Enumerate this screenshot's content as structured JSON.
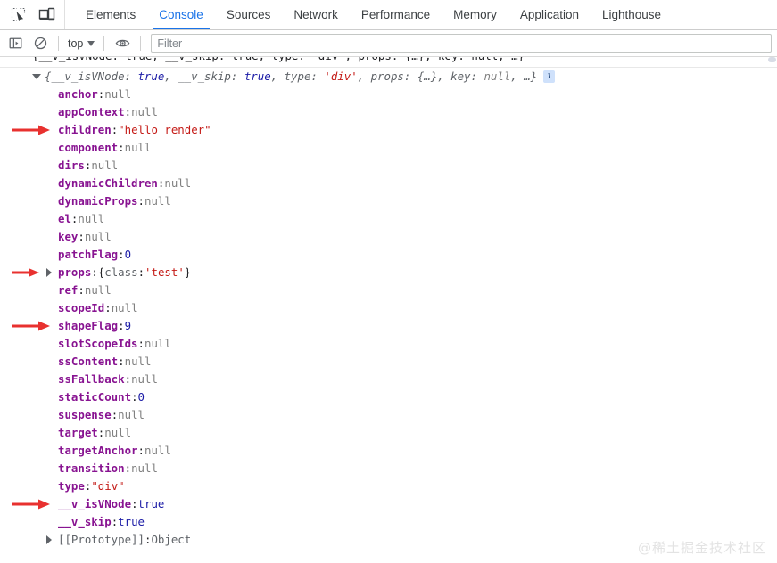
{
  "devtools": {
    "left_icons": [
      {
        "name": "inspect-element-icon",
        "title": "Inspect element"
      },
      {
        "name": "device-toolbar-icon",
        "title": "Toggle device toolbar"
      }
    ],
    "tabs": [
      {
        "label": "Elements",
        "active": false
      },
      {
        "label": "Console",
        "active": true
      },
      {
        "label": "Sources",
        "active": false
      },
      {
        "label": "Network",
        "active": false
      },
      {
        "label": "Performance",
        "active": false
      },
      {
        "label": "Memory",
        "active": false
      },
      {
        "label": "Application",
        "active": false
      },
      {
        "label": "Lighthouse",
        "active": false
      }
    ],
    "active_tab_color": "#1a73e8"
  },
  "controls": {
    "sidebar_toggle_icon": "show-console-sidebar-icon",
    "clear_console_icon": "clear-console-icon",
    "context_label": "top",
    "context_caret_icon": "chevron-down-icon",
    "eye_icon": "live-expression-eye-icon",
    "filter": {
      "value": "",
      "placeholder": "Filter"
    }
  },
  "console": {
    "clipped_top_line": "{__v_isVNode: true, __v_skip: true, type: 'div', props: {…}, key: null, …}",
    "object_header": {
      "expander_icon": "triangle-down-icon",
      "open_brace": "{",
      "close_brace": "}",
      "parts": [
        {
          "key": "__v_isVNode",
          "value": "true",
          "kind": "bool"
        },
        {
          "key": "__v_skip",
          "value": "true",
          "kind": "bool"
        },
        {
          "key": "type",
          "value": "'div'",
          "kind": "str"
        },
        {
          "key": "props",
          "value": "{…}",
          "kind": "obj"
        },
        {
          "key": "key",
          "value": "null",
          "kind": "nul"
        }
      ],
      "ellipsis": "…",
      "info_badge": "i"
    },
    "properties": [
      {
        "name": "anchor",
        "value": "null",
        "kind": "null",
        "arrow": false,
        "expandable": false
      },
      {
        "name": "appContext",
        "value": "null",
        "kind": "null",
        "arrow": false,
        "expandable": false
      },
      {
        "name": "children",
        "value": "\"hello render\"",
        "kind": "str",
        "arrow": true,
        "expandable": false
      },
      {
        "name": "component",
        "value": "null",
        "kind": "null",
        "arrow": false,
        "expandable": false
      },
      {
        "name": "dirs",
        "value": "null",
        "kind": "null",
        "arrow": false,
        "expandable": false
      },
      {
        "name": "dynamicChildren",
        "value": "null",
        "kind": "null",
        "arrow": false,
        "expandable": false
      },
      {
        "name": "dynamicProps",
        "value": "null",
        "kind": "null",
        "arrow": false,
        "expandable": false
      },
      {
        "name": "el",
        "value": "null",
        "kind": "null",
        "arrow": false,
        "expandable": false
      },
      {
        "name": "key",
        "value": "null",
        "kind": "null",
        "arrow": false,
        "expandable": false
      },
      {
        "name": "patchFlag",
        "value": "0",
        "kind": "num",
        "arrow": false,
        "expandable": false
      },
      {
        "name": "props",
        "value": "{class: 'test'}",
        "kind": "objlit",
        "arrow": true,
        "expandable": true,
        "obj": {
          "open": "{",
          "key": "class",
          "sep": ": ",
          "val": "'test'",
          "close": "}"
        }
      },
      {
        "name": "ref",
        "value": "null",
        "kind": "null",
        "arrow": false,
        "expandable": false
      },
      {
        "name": "scopeId",
        "value": "null",
        "kind": "null",
        "arrow": false,
        "expandable": false
      },
      {
        "name": "shapeFlag",
        "value": "9",
        "kind": "num",
        "arrow": true,
        "expandable": false
      },
      {
        "name": "slotScopeIds",
        "value": "null",
        "kind": "null",
        "arrow": false,
        "expandable": false
      },
      {
        "name": "ssContent",
        "value": "null",
        "kind": "null",
        "arrow": false,
        "expandable": false
      },
      {
        "name": "ssFallback",
        "value": "null",
        "kind": "null",
        "arrow": false,
        "expandable": false
      },
      {
        "name": "staticCount",
        "value": "0",
        "kind": "num",
        "arrow": false,
        "expandable": false
      },
      {
        "name": "suspense",
        "value": "null",
        "kind": "null",
        "arrow": false,
        "expandable": false
      },
      {
        "name": "target",
        "value": "null",
        "kind": "null",
        "arrow": false,
        "expandable": false
      },
      {
        "name": "targetAnchor",
        "value": "null",
        "kind": "null",
        "arrow": false,
        "expandable": false
      },
      {
        "name": "transition",
        "value": "null",
        "kind": "null",
        "arrow": false,
        "expandable": false
      },
      {
        "name": "type",
        "value": "\"div\"",
        "kind": "str",
        "arrow": false,
        "expandable": false
      },
      {
        "name": "__v_isVNode",
        "value": "true",
        "kind": "bool",
        "arrow": true,
        "expandable": false
      },
      {
        "name": "__v_skip",
        "value": "true",
        "kind": "bool",
        "arrow": false,
        "expandable": false
      },
      {
        "name": "[[Prototype]]",
        "value": "Object",
        "kind": "proto",
        "arrow": false,
        "expandable": true
      }
    ],
    "annotation_arrow_color": "#e8312f"
  },
  "watermark": {
    "text": "@稀土掘金技术社区"
  }
}
